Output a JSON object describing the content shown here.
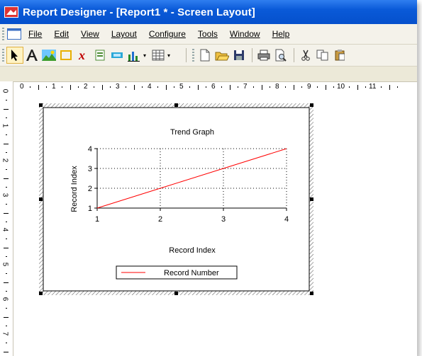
{
  "window": {
    "title": "Report Designer - [Report1 * - Screen Layout]"
  },
  "menu": {
    "items": [
      {
        "label": "File",
        "name": "menu-file"
      },
      {
        "label": "Edit",
        "name": "menu-edit"
      },
      {
        "label": "View",
        "name": "menu-view"
      },
      {
        "label": "Layout",
        "name": "menu-layout"
      },
      {
        "label": "Configure",
        "name": "menu-configure"
      },
      {
        "label": "Tools",
        "name": "menu-tools"
      },
      {
        "label": "Window",
        "name": "menu-window"
      },
      {
        "label": "Help",
        "name": "menu-help"
      }
    ]
  },
  "toolbar": {
    "tools": [
      "pointer-icon",
      "text-tool-icon",
      "image-tool-icon",
      "rectangle-tool-icon",
      "formula-tool-icon",
      "field-tool-icon",
      "barcode-tool-icon",
      "chart-tool-icon",
      "table-tool-icon",
      "new-document-icon",
      "open-folder-icon",
      "save-icon",
      "print-icon",
      "print-preview-icon",
      "cut-icon",
      "copy-icon",
      "paste-icon"
    ]
  },
  "ruler": {
    "horizontal": [
      "0",
      "1",
      "2",
      "3",
      "4",
      "5",
      "6",
      "7",
      "8",
      "9",
      "10",
      "11"
    ],
    "vertical": [
      "0",
      "1",
      "2",
      "3",
      "4",
      "5",
      "6",
      "7"
    ]
  },
  "chart_data": {
    "type": "line",
    "title": "Trend Graph",
    "xlabel": "Record Index",
    "ylabel": "Record Index",
    "x": [
      1,
      2,
      3,
      4
    ],
    "series": [
      {
        "name": "Record Number",
        "values": [
          1,
          2,
          3,
          4
        ],
        "color": "#ff0000"
      }
    ],
    "xlim": [
      1,
      4
    ],
    "ylim": [
      1,
      4
    ],
    "xticks": [
      "1",
      "2",
      "3",
      "4"
    ],
    "yticks": [
      "1",
      "2",
      "3",
      "4"
    ],
    "grid": true,
    "legend": "bottom-center"
  },
  "colors": {
    "titlebar": "#0a5ad8",
    "series": "#ff0000",
    "handle": "#000000"
  }
}
